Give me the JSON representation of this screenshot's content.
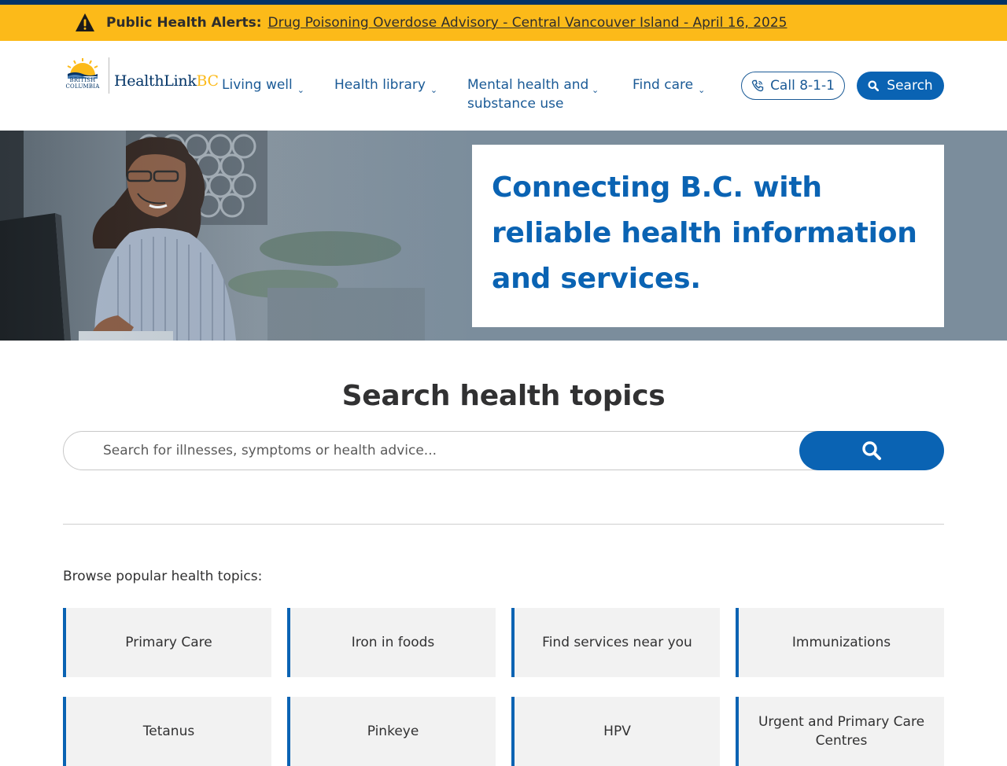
{
  "alert": {
    "title": "Public Health Alerts:",
    "link": "Drug Poisoning Overdose Advisory - Central Vancouver Island - April 16, 2025"
  },
  "logo": {
    "gov_line1": "BRITISH",
    "gov_line2": "COLUMBIA",
    "name_main": "HealthLink",
    "name_bc": "BC"
  },
  "nav": {
    "items": [
      {
        "label": "Living well"
      },
      {
        "label": "Health library"
      },
      {
        "label": "Mental health and substance use"
      },
      {
        "label": "Find care"
      }
    ]
  },
  "header": {
    "call_label": "Call 8-1-1",
    "search_label": "Search"
  },
  "hero": {
    "heading": "Connecting B.C. with reliable health information and services."
  },
  "search": {
    "title": "Search health topics",
    "placeholder": "Search for illnesses, symptoms or health advice..."
  },
  "browse": {
    "label": "Browse popular health topics:",
    "topics": [
      {
        "label": "Primary Care"
      },
      {
        "label": "Iron in foods"
      },
      {
        "label": "Find services near you"
      },
      {
        "label": "Immunizations"
      },
      {
        "label": "Tetanus"
      },
      {
        "label": "Pinkeye"
      },
      {
        "label": "HPV"
      },
      {
        "label": "Urgent and Primary Care Centres"
      }
    ]
  },
  "colors": {
    "alert_bg": "#fcba19",
    "brand_blue": "#0a63b3",
    "nav_blue": "#1a5a96",
    "navy": "#013366"
  }
}
